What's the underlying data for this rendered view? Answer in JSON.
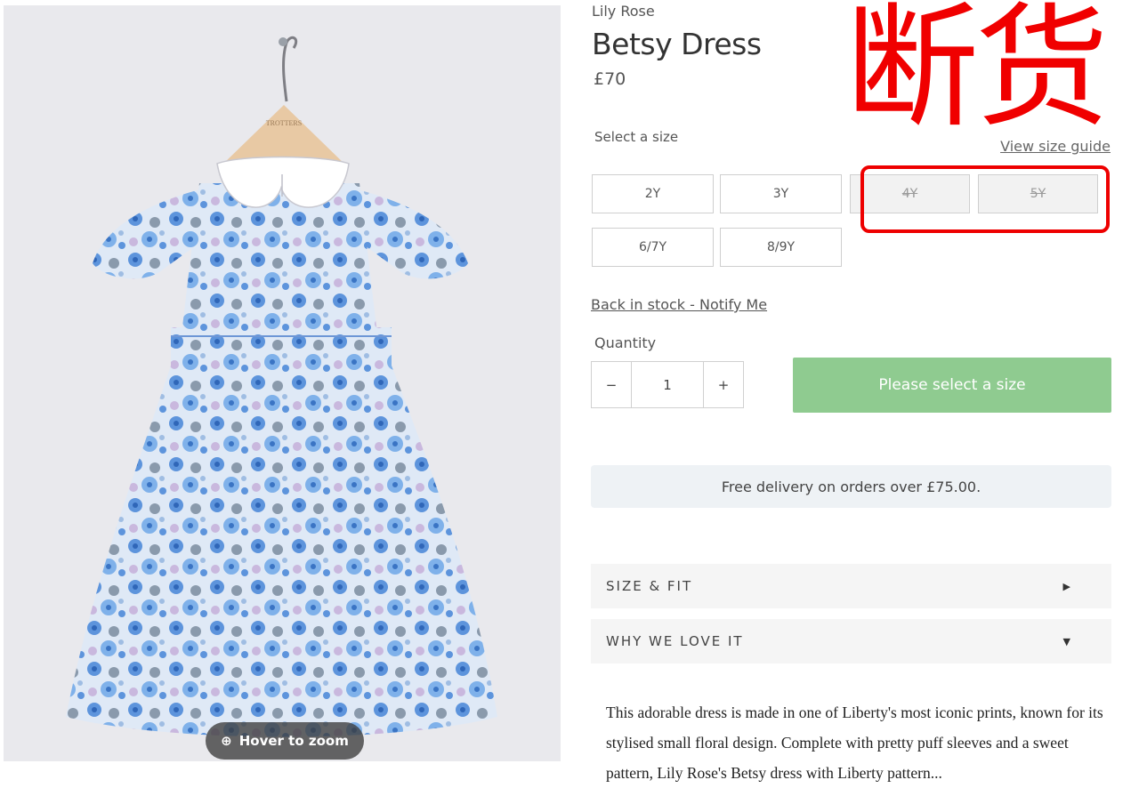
{
  "product": {
    "brand": "Lily Rose",
    "title": "Betsy Dress",
    "price": "£70",
    "image_zoom_label": "Hover to zoom",
    "hanger_text": "TROTTERS",
    "stamp_text": "断货"
  },
  "size": {
    "label": "Select a size",
    "guide_link": "View size guide",
    "options": [
      {
        "label": "2Y",
        "available": true
      },
      {
        "label": "3Y",
        "available": true
      },
      {
        "label": "4Y",
        "available": false
      },
      {
        "label": "5Y",
        "available": false
      },
      {
        "label": "6/7Y",
        "available": true
      },
      {
        "label": "8/9Y",
        "available": true
      }
    ]
  },
  "notify_link": "Back in stock - Notify Me",
  "quantity": {
    "label": "Quantity",
    "minus": "−",
    "value": "1",
    "plus": "+"
  },
  "add_button_label": "Please select a size",
  "delivery_note": "Free delivery on orders over £75.00.",
  "accordions": [
    {
      "label": "SIZE & FIT",
      "state": "collapsed"
    },
    {
      "label": "WHY WE LOVE IT",
      "state": "expanded"
    }
  ],
  "description": "This adorable dress is made in one of Liberty's most iconic prints, known for its stylised small floral design. Complete with pretty puff sleeves and a sweet pattern, Lily Rose's Betsy dress with Liberty pattern...",
  "colors": {
    "stamp": "#f00000",
    "button": "#8fcb90",
    "delivery_bg": "#eef2f5",
    "dress_blue": "#6fa2dd"
  }
}
